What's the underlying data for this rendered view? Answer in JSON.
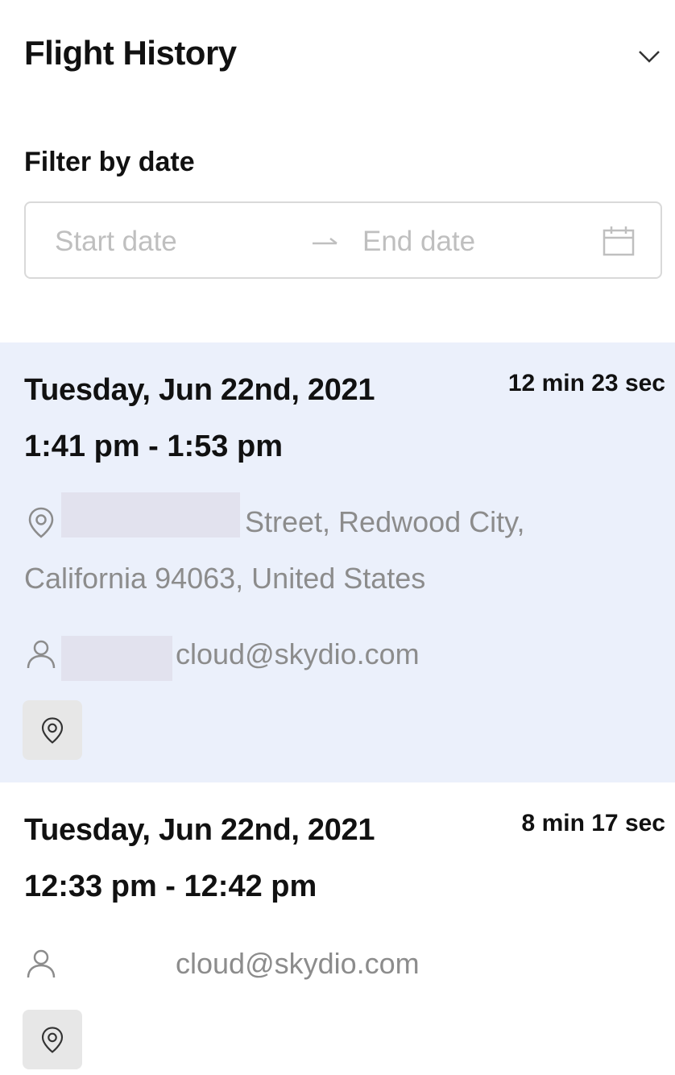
{
  "header": {
    "title": "Flight History",
    "collapse_icon": "chevron-down-icon"
  },
  "filter": {
    "label": "Filter by date",
    "start_placeholder": "Start date",
    "end_placeholder": "End date",
    "separator_icon": "arrow-right-icon",
    "calendar_icon": "calendar-icon"
  },
  "flights": [
    {
      "date": "Tuesday, Jun 22nd, 2021",
      "duration": "12 min 23 sec",
      "time_range": "1:41 pm - 1:53 pm",
      "address_line1": "Street, Redwood City,",
      "address_line2": "California 94063, United States",
      "user_email": "cloud@skydio.com",
      "selected": true
    },
    {
      "date": "Tuesday, Jun 22nd, 2021",
      "duration": "8 min 17 sec",
      "time_range": "12:33 pm - 12:42 pm",
      "user_email": "cloud@skydio.com",
      "selected": false
    }
  ],
  "colors": {
    "selected_background": "#ebf0fb",
    "muted_text": "#8c8c8c",
    "title_text": "#111111"
  }
}
